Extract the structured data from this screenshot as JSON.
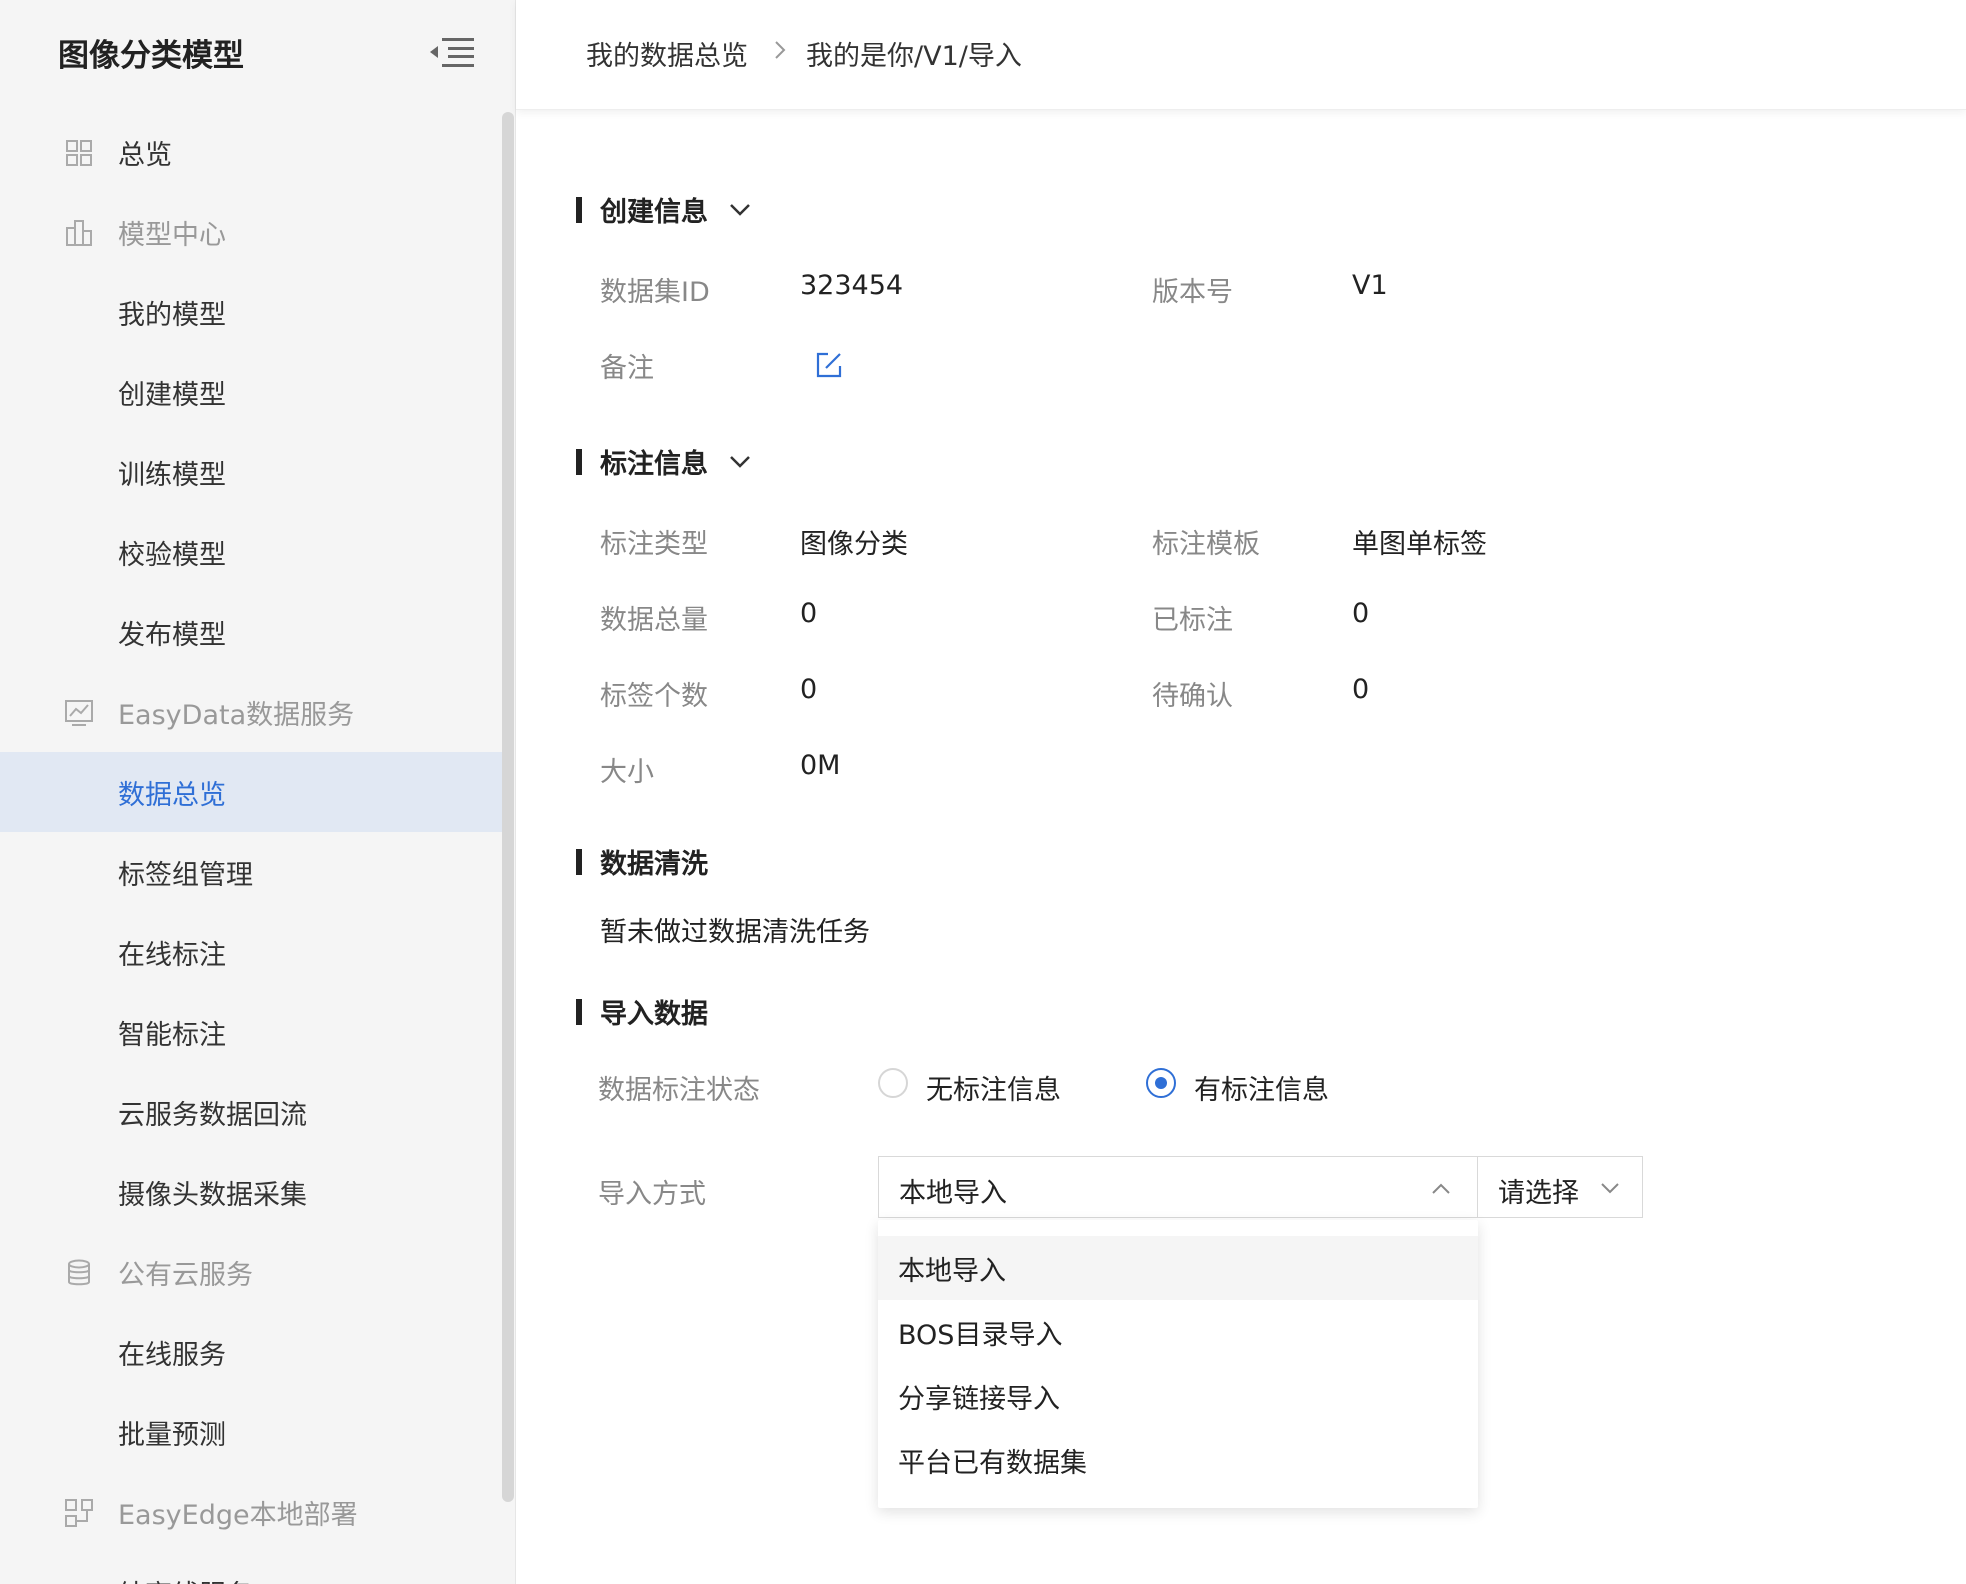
{
  "sidebar": {
    "title": "图像分类模型",
    "items": [
      {
        "label": "总览",
        "type": "top",
        "icon": "grid-icon"
      },
      {
        "label": "模型中心",
        "type": "group",
        "icon": "building-icon"
      },
      {
        "label": "我的模型",
        "type": "leaf"
      },
      {
        "label": "创建模型",
        "type": "leaf"
      },
      {
        "label": "训练模型",
        "type": "leaf"
      },
      {
        "label": "校验模型",
        "type": "leaf"
      },
      {
        "label": "发布模型",
        "type": "leaf"
      },
      {
        "label": "EasyData数据服务",
        "type": "group",
        "icon": "chart-monitor-icon"
      },
      {
        "label": "数据总览",
        "type": "leaf",
        "active": true
      },
      {
        "label": "标签组管理",
        "type": "leaf"
      },
      {
        "label": "在线标注",
        "type": "leaf"
      },
      {
        "label": "智能标注",
        "type": "leaf"
      },
      {
        "label": "云服务数据回流",
        "type": "leaf"
      },
      {
        "label": "摄像头数据采集",
        "type": "leaf"
      },
      {
        "label": "公有云服务",
        "type": "group",
        "icon": "database-icon"
      },
      {
        "label": "在线服务",
        "type": "leaf"
      },
      {
        "label": "批量预测",
        "type": "leaf"
      },
      {
        "label": "EasyEdge本地部署",
        "type": "group",
        "icon": "deploy-icon"
      },
      {
        "label": "纯离线服务",
        "type": "leaf"
      }
    ]
  },
  "breadcrumb": {
    "first": "我的数据总览",
    "second": "我的是你/V1/导入"
  },
  "create_info": {
    "title": "创建信息",
    "dataset_id_label": "数据集ID",
    "dataset_id": "323454",
    "version_label": "版本号",
    "version": "V1",
    "note_label": "备注"
  },
  "annotation_info": {
    "title": "标注信息",
    "type_label": "标注类型",
    "type": "图像分类",
    "template_label": "标注模板",
    "template": "单图单标签",
    "total_label": "数据总量",
    "total": "0",
    "annotated_label": "已标注",
    "annotated": "0",
    "tag_count_label": "标签个数",
    "tag_count": "0",
    "pending_label": "待确认",
    "pending": "0",
    "size_label": "大小",
    "size": "0M"
  },
  "cleaning": {
    "title": "数据清洗",
    "text": "暂未做过数据清洗任务"
  },
  "import": {
    "title": "导入数据",
    "status_label": "数据标注状态",
    "radio_no": "无标注信息",
    "radio_yes": "有标注信息",
    "selected_radio": "有标注信息",
    "method_label": "导入方式",
    "method_value": "本地导入",
    "second_select_placeholder": "请选择",
    "options": [
      "本地导入",
      "BOS目录导入",
      "分享链接导入",
      "平台已有数据集"
    ]
  },
  "colors": {
    "accent": "#2f6fd6",
    "active_bg": "#e1e8f3",
    "sidebar_bg": "#f5f5f5"
  }
}
